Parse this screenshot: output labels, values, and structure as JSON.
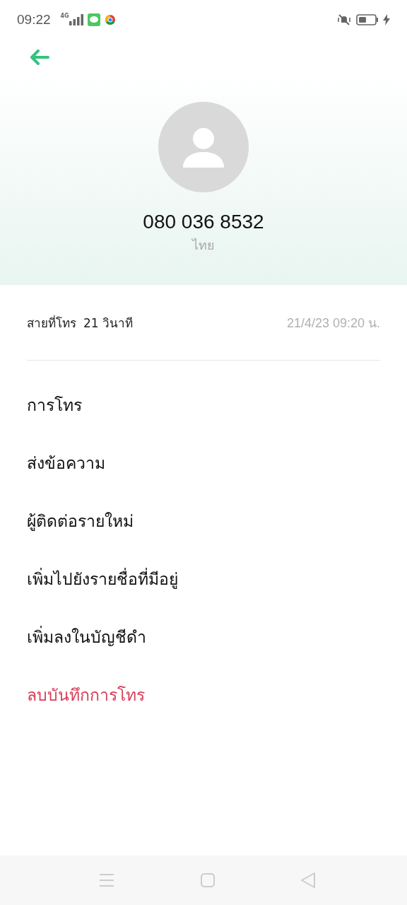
{
  "status_bar": {
    "time": "09:22",
    "network": "4G"
  },
  "contact": {
    "number": "080 036 8532",
    "location": "ไทย"
  },
  "call_log": {
    "type": "สายที่โทร",
    "duration": "21 วินาที",
    "datetime": "21/4/23 09:20 น."
  },
  "actions": [
    {
      "label": "การโทร",
      "kind": "normal"
    },
    {
      "label": "ส่งข้อความ",
      "kind": "normal"
    },
    {
      "label": "ผู้ติดต่อรายใหม่",
      "kind": "normal"
    },
    {
      "label": "เพิ่มไปยังรายชื่อที่มีอยู่",
      "kind": "normal"
    },
    {
      "label": "เพิ่มลงในบัญชีดำ",
      "kind": "normal"
    },
    {
      "label": "ลบบันทึกการโทร",
      "kind": "danger"
    }
  ]
}
